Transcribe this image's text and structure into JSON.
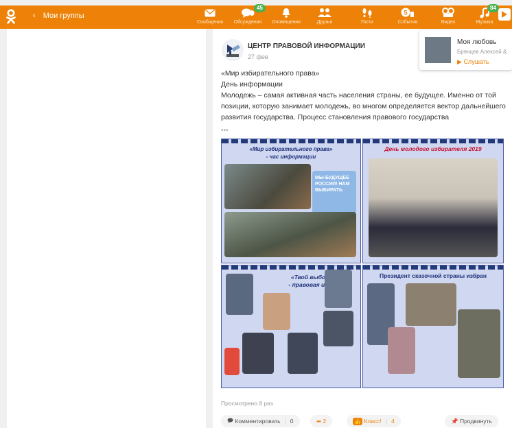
{
  "header": {
    "back_label": "Мои группы",
    "nav": [
      {
        "key": "messages",
        "label": "Сообщения",
        "icon": "envelope-icon"
      },
      {
        "key": "discussions",
        "label": "Обсуждения",
        "icon": "chat-icon",
        "badge": "45"
      },
      {
        "key": "notifications",
        "label": "Оповещения",
        "icon": "bell-icon"
      },
      {
        "key": "friends",
        "label": "Друзья",
        "icon": "friends-icon"
      },
      {
        "key": "guests",
        "label": "Гости",
        "icon": "footprints-icon"
      },
      {
        "key": "events",
        "label": "События",
        "icon": "events-icon"
      },
      {
        "key": "video",
        "label": "Видео",
        "icon": "video-icon"
      },
      {
        "key": "music",
        "label": "Музыка",
        "icon": "music-icon",
        "badge": "84"
      }
    ],
    "accent_color": "#ee8208"
  },
  "post": {
    "group_name": "ЦЕНТР ПРАВОВОЙ ИНФОРМАЦИИ",
    "date": "27 фев",
    "lines": [
      "«Мир избирательного права»",
      "День информации",
      "Молодежь – самая активная часть населения страны, ее будущее. Именно от той позиции, которую занимает молодежь, во многом определяется вектор дальнейшего развития государства. Процесс становления правового государства"
    ],
    "more": "•••",
    "collage": {
      "panel1_title_line1": "«Мир избирательного права»",
      "panel1_title_line2": "- час информации",
      "panel1_sign": "МЫ-БУДУЩЕЕ РОССИИ! НАМ ВЫБИРАТЬ",
      "panel2_title": "День молодого избирателя 2019",
      "panel3_title_line1": "«Твой выбор»",
      "panel3_title_line2": "- правовая игра",
      "panel4_title": "Президент сказочной страны избран"
    },
    "views": "Просмотрено 8 раз",
    "actions": {
      "comment_label": "Комментировать",
      "comment_count": "0",
      "share_count": "2",
      "like_label": "Класс!",
      "like_count": "4",
      "promote_label": "Продвинуть"
    }
  },
  "music_popup": {
    "song": "Моя любовь",
    "artist": "Брянцев Алексей &",
    "listen_label": "Слушать"
  }
}
